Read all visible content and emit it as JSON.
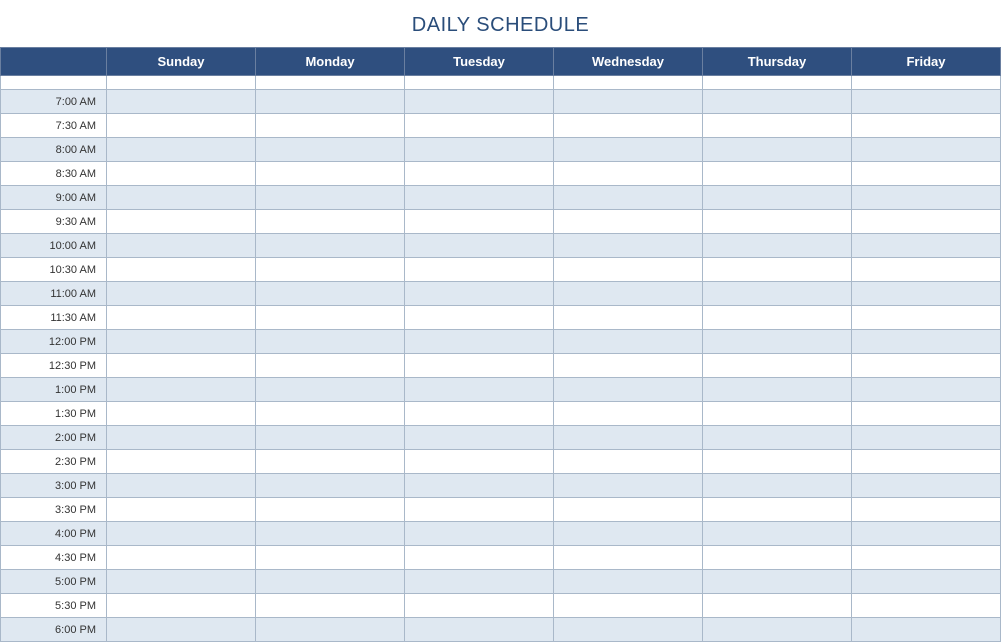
{
  "title": "DAILY SCHEDULE",
  "days": [
    "Sunday",
    "Monday",
    "Tuesday",
    "Wednesday",
    "Thursday",
    "Friday"
  ],
  "times": [
    "7:00 AM",
    "7:30 AM",
    "8:00 AM",
    "8:30 AM",
    "9:00 AM",
    "9:30 AM",
    "10:00 AM",
    "10:30 AM",
    "11:00 AM",
    "11:30 AM",
    "12:00 PM",
    "12:30 PM",
    "1:00 PM",
    "1:30 PM",
    "2:00 PM",
    "2:30 PM",
    "3:00 PM",
    "3:30 PM",
    "4:00 PM",
    "4:30 PM",
    "5:00 PM",
    "5:30 PM",
    "6:00 PM"
  ],
  "colors": {
    "headerBg": "#2f4f7f",
    "altRowBg": "#dfe8f1",
    "titleColor": "#2a4d7a"
  },
  "chart_data": {
    "type": "table",
    "title": "DAILY SCHEDULE",
    "columns": [
      "",
      "Sunday",
      "Monday",
      "Tuesday",
      "Wednesday",
      "Thursday",
      "Friday"
    ],
    "rows": [
      [
        "7:00 AM",
        "",
        "",
        "",
        "",
        "",
        ""
      ],
      [
        "7:30 AM",
        "",
        "",
        "",
        "",
        "",
        ""
      ],
      [
        "8:00 AM",
        "",
        "",
        "",
        "",
        "",
        ""
      ],
      [
        "8:30 AM",
        "",
        "",
        "",
        "",
        "",
        ""
      ],
      [
        "9:00 AM",
        "",
        "",
        "",
        "",
        "",
        ""
      ],
      [
        "9:30 AM",
        "",
        "",
        "",
        "",
        "",
        ""
      ],
      [
        "10:00 AM",
        "",
        "",
        "",
        "",
        "",
        ""
      ],
      [
        "10:30 AM",
        "",
        "",
        "",
        "",
        "",
        ""
      ],
      [
        "11:00 AM",
        "",
        "",
        "",
        "",
        "",
        ""
      ],
      [
        "11:30 AM",
        "",
        "",
        "",
        "",
        "",
        ""
      ],
      [
        "12:00 PM",
        "",
        "",
        "",
        "",
        "",
        ""
      ],
      [
        "12:30 PM",
        "",
        "",
        "",
        "",
        "",
        ""
      ],
      [
        "1:00 PM",
        "",
        "",
        "",
        "",
        "",
        ""
      ],
      [
        "1:30 PM",
        "",
        "",
        "",
        "",
        "",
        ""
      ],
      [
        "2:00 PM",
        "",
        "",
        "",
        "",
        "",
        ""
      ],
      [
        "2:30 PM",
        "",
        "",
        "",
        "",
        "",
        ""
      ],
      [
        "3:00 PM",
        "",
        "",
        "",
        "",
        "",
        ""
      ],
      [
        "3:30 PM",
        "",
        "",
        "",
        "",
        "",
        ""
      ],
      [
        "4:00 PM",
        "",
        "",
        "",
        "",
        "",
        ""
      ],
      [
        "4:30 PM",
        "",
        "",
        "",
        "",
        "",
        ""
      ],
      [
        "5:00 PM",
        "",
        "",
        "",
        "",
        "",
        ""
      ],
      [
        "5:30 PM",
        "",
        "",
        "",
        "",
        "",
        ""
      ],
      [
        "6:00 PM",
        "",
        "",
        "",
        "",
        "",
        ""
      ]
    ]
  }
}
